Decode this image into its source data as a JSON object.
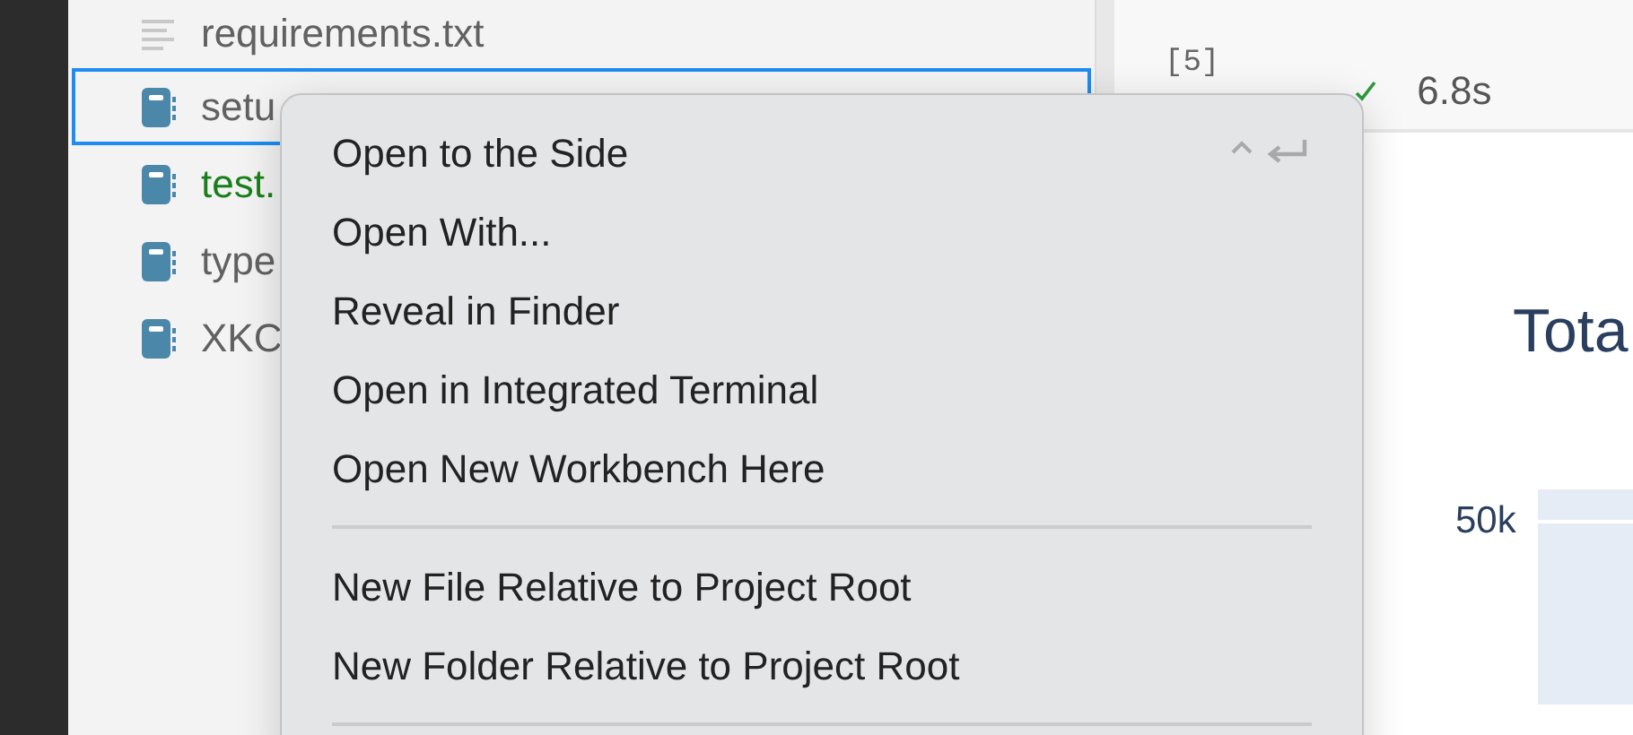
{
  "explorer": {
    "files": [
      {
        "name": "requirements.txt",
        "kind": "text",
        "selected": false,
        "modified": false
      },
      {
        "name": "setu",
        "kind": "notebook",
        "selected": true,
        "modified": false
      },
      {
        "name": "test.",
        "kind": "notebook",
        "selected": false,
        "modified": true
      },
      {
        "name": "type",
        "kind": "notebook",
        "selected": false,
        "modified": false
      },
      {
        "name": "XKC",
        "kind": "notebook",
        "selected": false,
        "modified": false
      }
    ]
  },
  "cell": {
    "prompt": "[5]",
    "success": true,
    "duration": "6.8s"
  },
  "output": {
    "title": "Tota",
    "tick": "50k"
  },
  "context_menu": {
    "items": [
      {
        "kind": "item",
        "label": "Open to the Side",
        "shortcut": true
      },
      {
        "kind": "item",
        "label": "Open With...",
        "shortcut": false
      },
      {
        "kind": "item",
        "label": "Reveal in Finder",
        "shortcut": false
      },
      {
        "kind": "item",
        "label": "Open in Integrated Terminal",
        "shortcut": false
      },
      {
        "kind": "item",
        "label": "Open New Workbench Here",
        "shortcut": false
      },
      {
        "kind": "separator"
      },
      {
        "kind": "item",
        "label": "New File Relative to Project Root",
        "shortcut": false
      },
      {
        "kind": "item",
        "label": "New Folder Relative to Project Root",
        "shortcut": false
      },
      {
        "kind": "separator"
      }
    ]
  }
}
